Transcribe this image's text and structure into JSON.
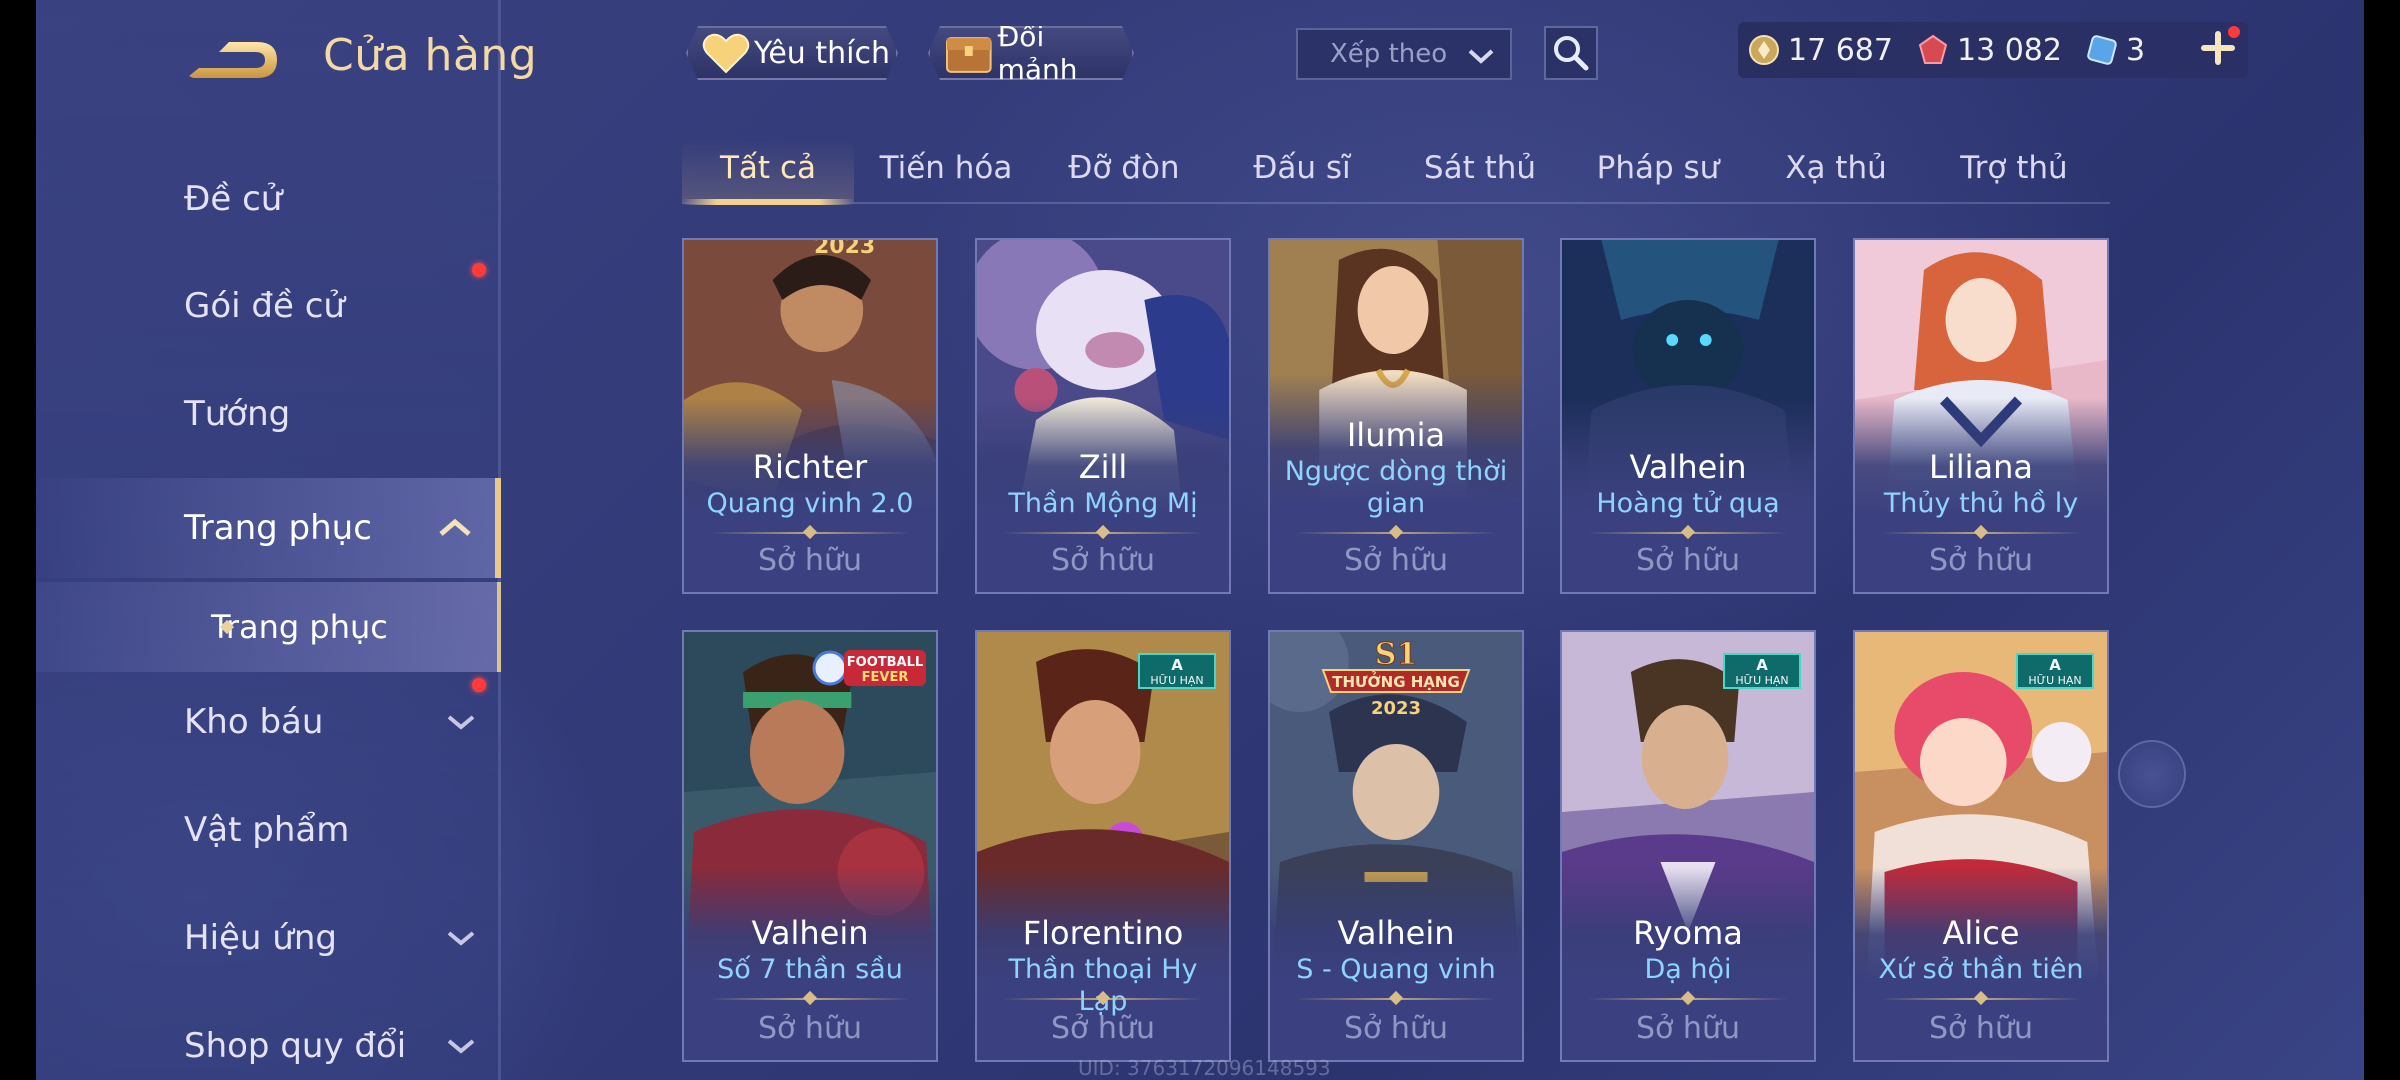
{
  "header": {
    "title": "Cửa hàng",
    "favorite_label": "Yêu thích",
    "exchange_label": "Đổi mảnh",
    "sort_placeholder": "Xếp theo"
  },
  "currency": {
    "gold": "17 687",
    "vouchers": "13 082",
    "tickets": "3"
  },
  "sidebar": {
    "items": [
      {
        "label": "Đề cử"
      },
      {
        "label": "Gói đề cử"
      },
      {
        "label": "Tướng"
      },
      {
        "label": "Trang phục"
      },
      {
        "label": "Trang phục"
      },
      {
        "label": "Kho báu"
      },
      {
        "label": "Vật phẩm"
      },
      {
        "label": "Hiệu ứng"
      },
      {
        "label": "Shop quy đổi"
      }
    ]
  },
  "tabs": [
    "Tất cả",
    "Tiến hóa",
    "Đỡ đòn",
    "Đấu sĩ",
    "Sát thủ",
    "Pháp sư",
    "Xạ thủ",
    "Trợ thủ"
  ],
  "cards": [
    {
      "hero": "Richter",
      "skin": "Quang vinh 2.0",
      "status": "Sở hữu"
    },
    {
      "hero": "Zill",
      "skin": "Thần Mộng Mị",
      "status": "Sở hữu"
    },
    {
      "hero": "Ilumia",
      "skin": "Ngược dòng thời gian",
      "status": "Sở hữu"
    },
    {
      "hero": "Valhein",
      "skin": "Hoàng tử quạ",
      "status": "Sở hữu"
    },
    {
      "hero": "Liliana",
      "skin": "Thủy thủ hồ ly",
      "status": "Sở hữu"
    },
    {
      "hero": "Valhein",
      "skin": "Số 7 thần sầu",
      "status": "Sở hữu"
    },
    {
      "hero": "Florentino",
      "skin": "Thần thoại Hy Lạp",
      "status": "Sở hữu"
    },
    {
      "hero": "Valhein",
      "skin": "S - Quang vinh",
      "status": "Sở hữu"
    },
    {
      "hero": "Ryoma",
      "skin": "Dạ hội",
      "status": "Sở hữu"
    },
    {
      "hero": "Alice",
      "skin": "Xứ sở thần tiên",
      "status": "Sở hữu"
    }
  ],
  "badges": {
    "limited_a": "A",
    "limited_text": "HỮU HẠN",
    "football_line1": "FOOTBALL",
    "football_line2": "FEVER",
    "s1_title": "S1",
    "s1_sub": "THƯỞNG HẠNG",
    "s1_year": "2023",
    "richter_year": "2023"
  },
  "uid_text": "UID: 3763172096148593",
  "colors": {
    "accent_gold": "#f3d08c",
    "skin_name_blue": "#8fd3ff",
    "notification_red": "#ff3a3a"
  }
}
